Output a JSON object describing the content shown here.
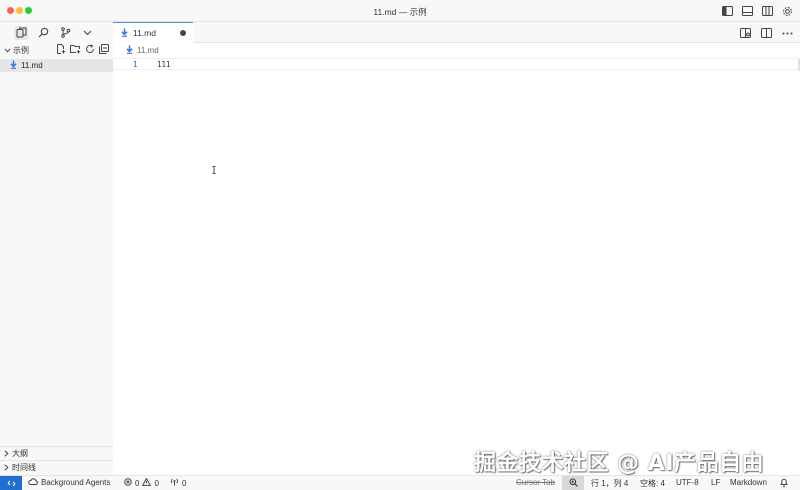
{
  "window": {
    "title": "11.md — 示例"
  },
  "editor": {
    "tab_label": "11.md",
    "breadcrumb": "11.md",
    "lines": [
      {
        "number": "1",
        "text": "111"
      }
    ]
  },
  "sidebar": {
    "folder_title": "示例",
    "file_label": "11.md",
    "outline_label": "大纲",
    "timeline_label": "时间线"
  },
  "status": {
    "agents_label": "Background Agents",
    "errors": "0",
    "warnings": "0",
    "ports": "0",
    "cursor_tab": "Cursor Tab",
    "position": "行 1，列 4",
    "spaces": "空格: 4",
    "encoding": "UTF-8",
    "eol": "LF",
    "language": "Markdown"
  },
  "watermark": "掘金技术社区 @ AI产品自由",
  "colors": {
    "accent": "#1f6fd1",
    "tab_border": "#4d8ee8",
    "markdown_icon": "#3b7dd8"
  }
}
